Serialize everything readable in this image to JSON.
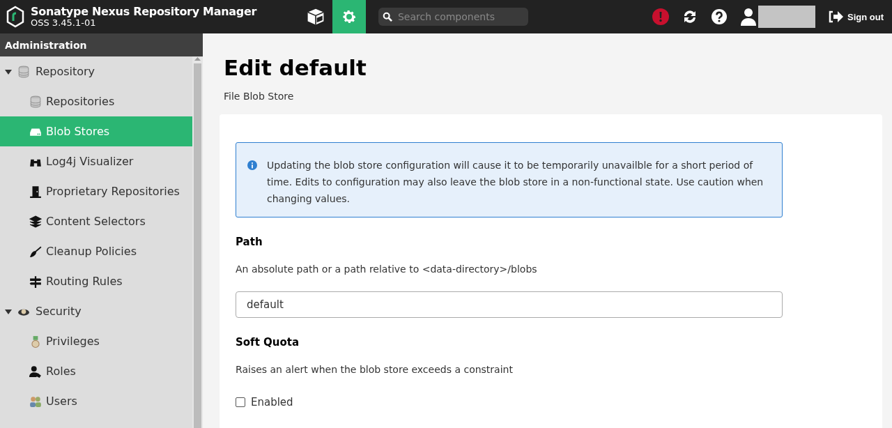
{
  "header": {
    "title": "Sonatype Nexus Repository Manager",
    "version": "OSS 3.45.1-01",
    "modes": [
      {
        "selected": false
      },
      {
        "selected": true
      }
    ],
    "search": {
      "placeholder": "Search components"
    },
    "sign_out": "Sign out"
  },
  "sidebar": {
    "title": "Administration",
    "items": [
      {
        "label": "Repository",
        "expanded": true,
        "selected": false,
        "children": [
          {
            "label": "Repositories",
            "selected": false
          },
          {
            "label": "Blob Stores",
            "selected": true
          },
          {
            "label": "Log4j Visualizer",
            "selected": false
          },
          {
            "label": "Proprietary Repositories",
            "selected": false
          },
          {
            "label": "Content Selectors",
            "selected": false
          },
          {
            "label": "Cleanup Policies",
            "selected": false
          },
          {
            "label": "Routing Rules",
            "selected": false
          }
        ]
      },
      {
        "label": "Security",
        "expanded": true,
        "selected": false,
        "children": [
          {
            "label": "Privileges",
            "selected": false
          },
          {
            "label": "Roles",
            "selected": false
          },
          {
            "label": "Users",
            "selected": false
          }
        ]
      }
    ]
  },
  "page": {
    "title": "Edit default",
    "subtitle": "File Blob Store",
    "notice": "Updating the blob store configuration will cause it to be temporarily unavailble for a short period of time. Edits to configuration may also leave the blob store in a non-functional state. Use caution when changing values.",
    "path": {
      "label": "Path",
      "help": "An absolute path or a path relative to <data-directory>/blobs",
      "value": "default"
    },
    "soft_quota": {
      "label": "Soft Quota",
      "help": "Raises an alert when the blob store exceeds a constraint",
      "enabled": {
        "label": "Enabled",
        "checked": false
      }
    }
  }
}
